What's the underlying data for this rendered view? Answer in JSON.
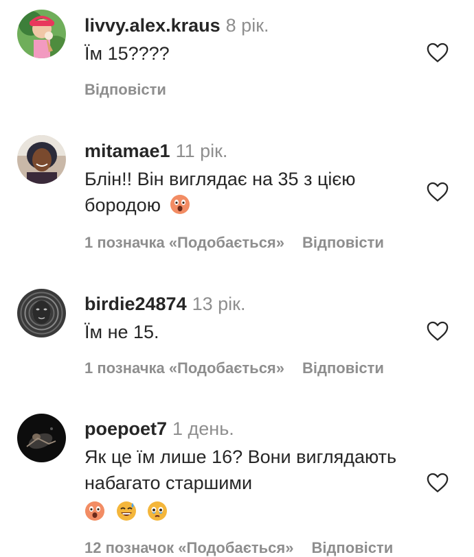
{
  "comments": [
    {
      "username": "livvy.alex.kraus",
      "time": "8 рік.",
      "text": "Їм 15????",
      "likes": "",
      "reply": "Відповісти"
    },
    {
      "username": "mitamae1",
      "time": "11 рік.",
      "text": "Блін!! Він виглядає на 35 з цією бородою",
      "likes": "1 позначка «Подобається»",
      "reply": "Відповісти"
    },
    {
      "username": "birdie24874",
      "time": "13 рік.",
      "text": "Їм не 15.",
      "likes": "1 позначка «Подобається»",
      "reply": "Відповісти"
    },
    {
      "username": "poepoet7",
      "time": "1 день.",
      "text": "Як це їм лише 16? Вони виглядають набагато старшими",
      "likes": "12 позначок «Подобається»",
      "reply": "Відповісти"
    }
  ],
  "emojis": {
    "comment2": [
      "astonished-face"
    ],
    "comment4": [
      "astonished-face",
      "grinning-sweat-face",
      "face-holding-back-tears"
    ]
  },
  "colors": {
    "username": "#262626",
    "muted": "#8e8e8e",
    "heart_outline": "#262626"
  }
}
